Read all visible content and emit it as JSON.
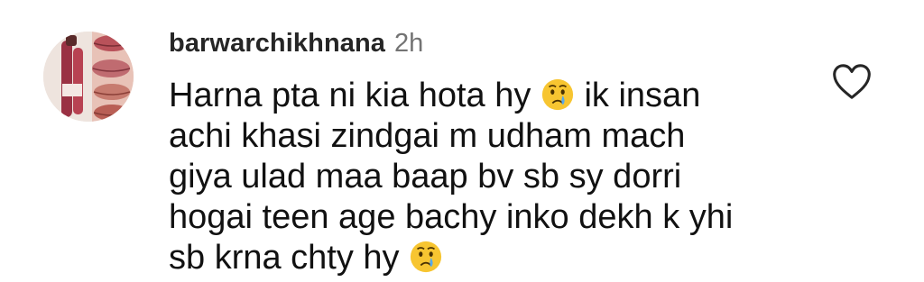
{
  "comment": {
    "avatar_icon": "lip-gloss-product-avatar",
    "username": "barwarchikhnana",
    "time": "2h",
    "lines": [
      {
        "before": "Harna pta ni kia hota hy",
        "emoji": "crying-face",
        "after": "ik insan"
      },
      {
        "text": "achi khasi zindgai m udham mach"
      },
      {
        "text": "giya ulad maa baap bv sb sy dorri"
      },
      {
        "text": "hogai teen age bachy inko dekh k yhi"
      },
      {
        "before": "sb krna chty hy",
        "emoji": "crying-face",
        "after": ""
      }
    ],
    "like_icon": "heart-outline-icon"
  },
  "colors": {
    "username": "#262626",
    "time": "#737373",
    "text": "#111111",
    "emoji_face": "#f7c531",
    "tear": "#58a9e8"
  }
}
